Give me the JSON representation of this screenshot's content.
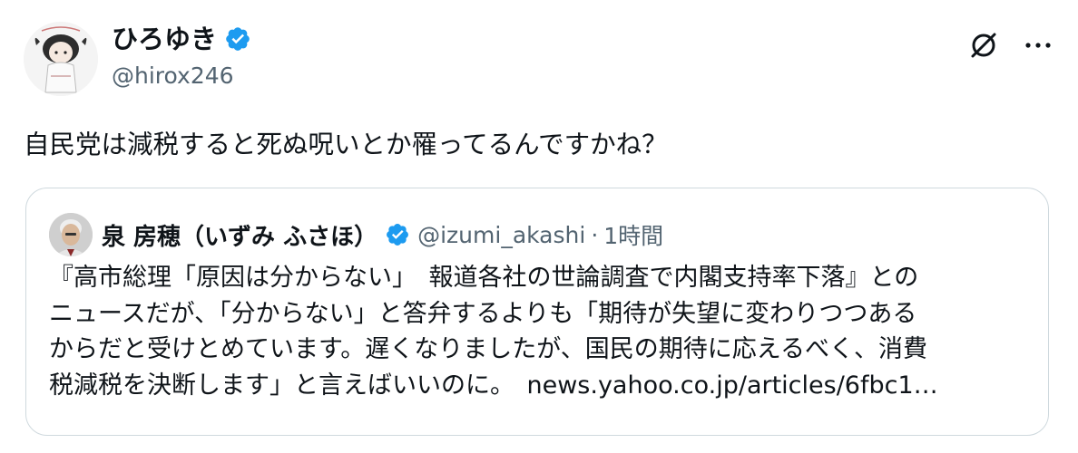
{
  "author": {
    "name": "ひろゆき",
    "handle": "@hirox246",
    "verified": true
  },
  "actions": {
    "grok_icon": "grok-icon",
    "more_icon": "more-icon"
  },
  "tweet": {
    "text": "自民党は減税すると死ぬ呪いとか罹ってるんですかね？"
  },
  "quote": {
    "name": "泉 房穂（いずみ ふさほ）",
    "handle": "@izumi_akashi",
    "separator": "·",
    "time": "1時間",
    "verified": true,
    "lines": [
      "『高市総理「原因は分からない」　報道各社の世論調査で内閣支持率下落』との",
      "ニュースだが、「分からない」と答弁するよりも「期待が失望に変わりつつある",
      "からだと受けとめています。遅くなりましたが、国民の期待に応えるべく、消費",
      "税減税を決断します」と言えばいいのに。"
    ],
    "link": "news.yahoo.co.jp/articles/6fbc1…"
  },
  "colors": {
    "verified": "#1d9bf0",
    "secondary_text": "#536471",
    "border": "#cfd9de"
  }
}
